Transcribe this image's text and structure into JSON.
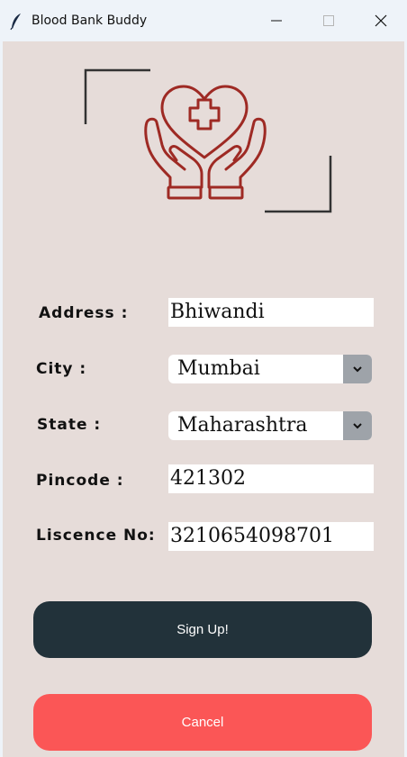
{
  "window": {
    "title": "Blood Bank Buddy",
    "icon": "feather-icon"
  },
  "form": {
    "address_label": "Address  :",
    "address_value": "Bhiwandi",
    "city_label": "City :",
    "city_value": "Mumbai",
    "state_label": "State :",
    "state_value": "Maharashtra",
    "pincode_label": "Pincode :",
    "pincode_value": "421302",
    "licence_label": "Liscence No:",
    "licence_value": "3210654098701"
  },
  "buttons": {
    "signup_label": "Sign Up!",
    "cancel_label": "Cancel"
  },
  "colors": {
    "background": "#e6dcd9",
    "logo_red": "#9e2a24",
    "signup_bg": "#22323a",
    "cancel_bg": "#fb5656"
  }
}
